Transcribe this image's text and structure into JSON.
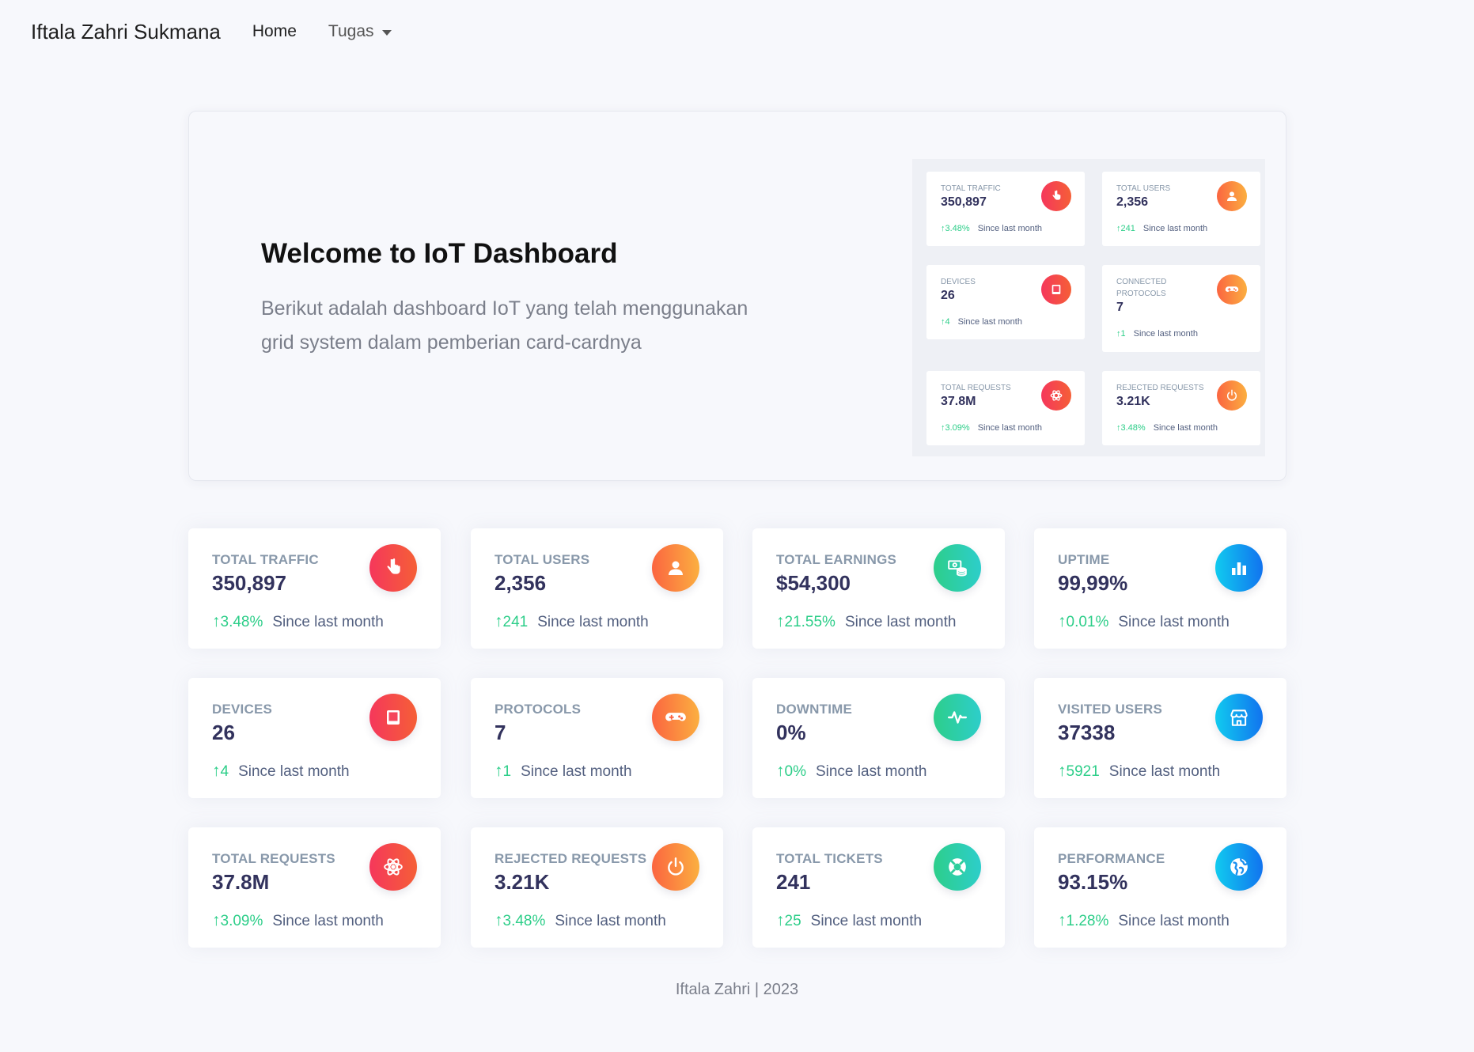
{
  "nav": {
    "brand": "Iftala Zahri Sukmana",
    "home": "Home",
    "tugas": "Tugas"
  },
  "hero": {
    "title": "Welcome to IoT Dashboard",
    "lead": "Berikut adalah dashboard IoT yang telah menggunakan grid system dalam pemberian card-cardnya",
    "preview": [
      {
        "title": "TOTAL TRAFFIC",
        "value": "350,897",
        "change": "3.48%",
        "since": "Since last month",
        "icon": "hand-pointer-icon",
        "color": "red"
      },
      {
        "title": "TOTAL USERS",
        "value": "2,356",
        "change": "241",
        "since": "Since last month",
        "icon": "user-icon",
        "color": "orange"
      },
      {
        "title": "DEVICES",
        "value": "26",
        "change": "4",
        "since": "Since last month",
        "icon": "tablet-icon",
        "color": "red"
      },
      {
        "title": "CONNECTED PROTOCOLS",
        "value": "7",
        "change": "1",
        "since": "Since last month",
        "icon": "gamepad-icon",
        "color": "orange"
      },
      {
        "title": "TOTAL REQUESTS",
        "value": "37.8M",
        "change": "3.09%",
        "since": "Since last month",
        "icon": "atom-icon",
        "color": "red"
      },
      {
        "title": "REJECTED REQUESTS",
        "value": "3.21K",
        "change": "3.48%",
        "since": "Since last month",
        "icon": "power-icon",
        "color": "orange"
      }
    ]
  },
  "cards": [
    {
      "title": "TOTAL TRAFFIC",
      "value": "350,897",
      "change": "3.48%",
      "since": "Since last month",
      "icon": "hand-pointer-icon",
      "color": "#f5365c"
    },
    {
      "title": "TOTAL USERS",
      "value": "2,356",
      "change": "241",
      "since": "Since last month",
      "icon": "user-icon",
      "color": "#fb6340"
    },
    {
      "title": "TOTAL EARNINGS",
      "value": "$54,300",
      "change": "21.55%",
      "since": "Since last month",
      "icon": "money-coins-icon",
      "color": "#2dce89"
    },
    {
      "title": "UPTIME",
      "value": "99,99%",
      "change": "0.01%",
      "since": "Since last month",
      "icon": "bar-chart-icon",
      "color": "#11cdef"
    },
    {
      "title": "DEVICES",
      "value": "26",
      "change": "4",
      "since": "Since last month",
      "icon": "tablet-icon",
      "color": "#f5365c"
    },
    {
      "title": "PROTOCOLS",
      "value": "7",
      "change": "1",
      "since": "Since last month",
      "icon": "gamepad-icon",
      "color": "#fb6340"
    },
    {
      "title": "DOWNTIME",
      "value": "0%",
      "change": "0%",
      "since": "Since last month",
      "icon": "pulse-icon",
      "color": "#2dce89"
    },
    {
      "title": "VISITED USERS",
      "value": "37338",
      "change": "5921",
      "since": "Since last month",
      "icon": "shop-icon",
      "color": "#11cdef"
    },
    {
      "title": "TOTAL REQUESTS",
      "value": "37.8M",
      "change": "3.09%",
      "since": "Since last month",
      "icon": "atom-icon",
      "color": "#f5365c"
    },
    {
      "title": "REJECTED REQUESTS",
      "value": "3.21K",
      "change": "3.48%",
      "since": "Since last month",
      "icon": "power-icon",
      "color": "#fb6340"
    },
    {
      "title": "TOTAL TICKETS",
      "value": "241",
      "change": "25",
      "since": "Since last month",
      "icon": "support-icon",
      "color": "#2dce89"
    },
    {
      "title": "PERFORMANCE",
      "value": "93.15%",
      "change": "1.28%",
      "since": "Since last month",
      "icon": "globe-icon",
      "color": "#11cdef"
    }
  ],
  "footer": "Iftala Zahri | 2023"
}
